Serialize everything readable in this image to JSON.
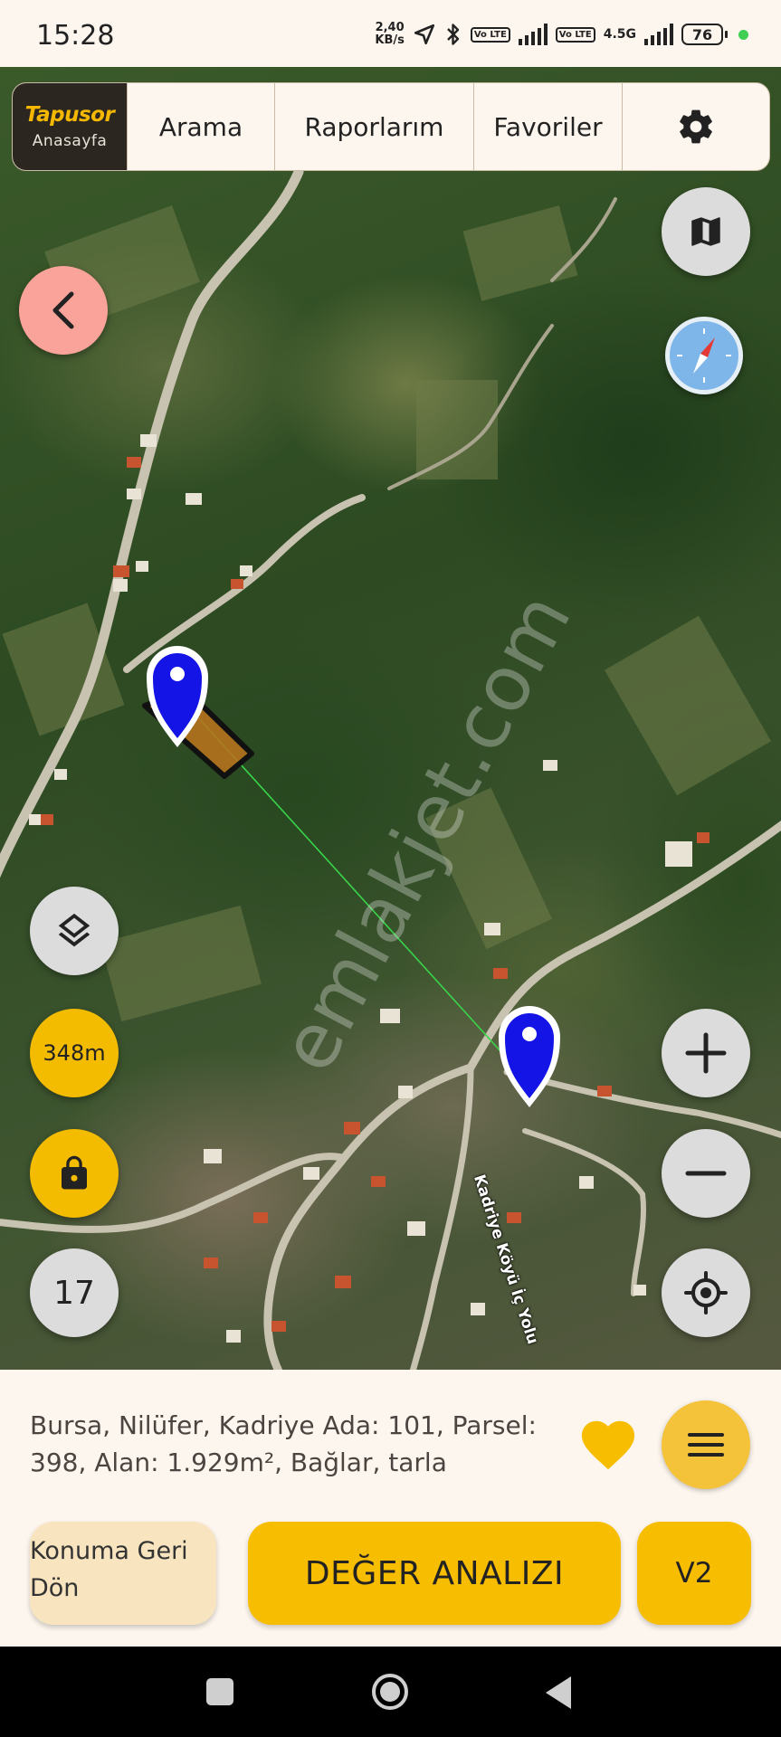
{
  "status_bar": {
    "time": "15:28",
    "net_speed_value": "2,40",
    "net_speed_unit": "KB/s",
    "volte_1": "Vo LTE",
    "volte_2": "Vo LTE",
    "network_type": "4.5G",
    "battery": "76"
  },
  "nav": {
    "brand": "Tapusor",
    "brand_sub": "Anasayfa",
    "search": "Arama",
    "reports": "Raporlarım",
    "favorites": "Favoriler",
    "settings_icon": "gear-icon"
  },
  "map": {
    "distance": "348m",
    "zoom_level": "17",
    "watermark": "emlakjet.com",
    "road_label": "Kadriye Köyü İç Yolu",
    "route_color": "#39d44a",
    "parcel_color": "#b8731c",
    "pin_color": "#1414e6"
  },
  "info": {
    "description": "Bursa, Nilüfer, Kadriye Ada: 101, Parsel: 398, Alan: 1.929m², Bağlar, tarla"
  },
  "actions": {
    "back_to_location": "Konuma Geri Dön",
    "value_analysis": "DEĞER ANALIZI",
    "version": "V2"
  },
  "colors": {
    "accent": "#f7bd00",
    "background": "#fdf6ee",
    "back_button": "#f9a39a"
  }
}
